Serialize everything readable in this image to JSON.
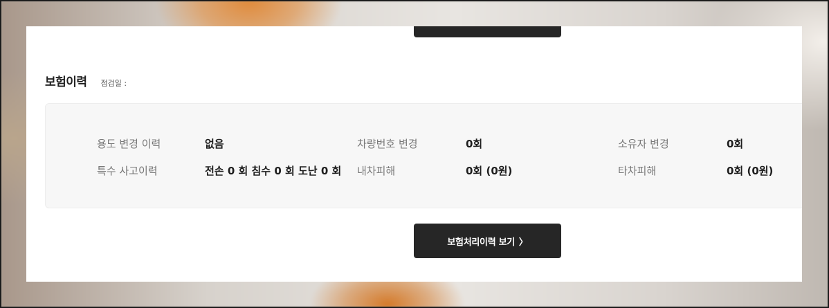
{
  "section": {
    "title": "보험이력",
    "check_date_label": "점검일 :"
  },
  "rows": [
    [
      {
        "label": "용도 변경 이력",
        "value": "없음"
      },
      {
        "label": "차량번호 변경",
        "value": "0회"
      },
      {
        "label": "소유자 변경",
        "value": "0회"
      }
    ],
    [
      {
        "label": "특수 사고이력",
        "value": "전손 0 회 침수 0 회 도난 0 회"
      },
      {
        "label": "내차피해",
        "value": "0회 (0원)"
      },
      {
        "label": "타차피해",
        "value": "0회 (0원)"
      }
    ]
  ],
  "button": {
    "label": "보험처리이력 보기",
    "chevron": "〉"
  }
}
